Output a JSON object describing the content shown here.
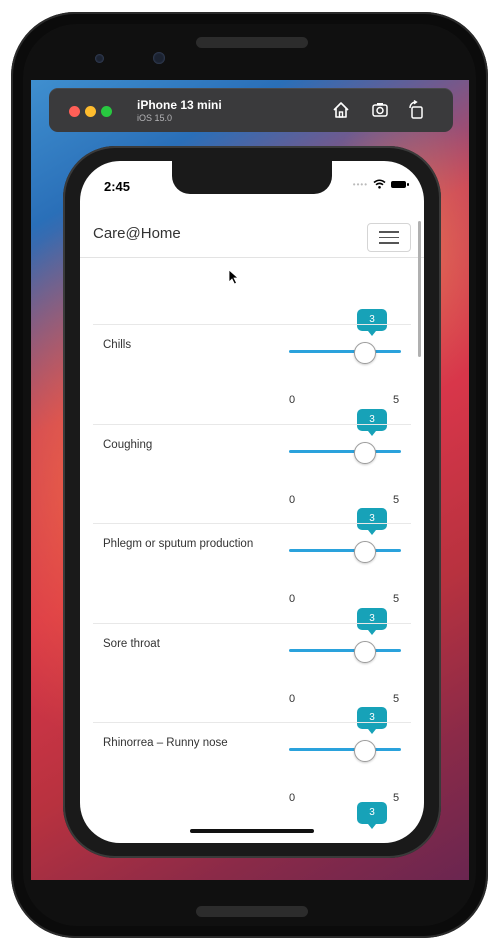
{
  "simulator": {
    "device_name": "iPhone 13 mini",
    "os_version": "iOS 15.0",
    "icons": [
      "home-icon",
      "screenshot-icon",
      "rotate-icon"
    ]
  },
  "status_bar": {
    "time": "2:45"
  },
  "app": {
    "title": "Care@Home",
    "menu_icon": "hamburger-menu-icon"
  },
  "slider_range": {
    "min": "0",
    "max": "5"
  },
  "symptoms": [
    {
      "label": "Chills",
      "value": "3",
      "level": 3
    },
    {
      "label": "Coughing",
      "value": "3",
      "level": 3
    },
    {
      "label": "Phlegm or sputum production",
      "value": "3",
      "level": 3
    },
    {
      "label": "Sore throat",
      "value": "3",
      "level": 3
    },
    {
      "label": "Rhinorrea – Runny nose",
      "value": "3",
      "level": 3
    }
  ],
  "partial_next_value": "3",
  "colors": {
    "accent": "#17a2b8",
    "slider_track": "#2aa2dc"
  }
}
